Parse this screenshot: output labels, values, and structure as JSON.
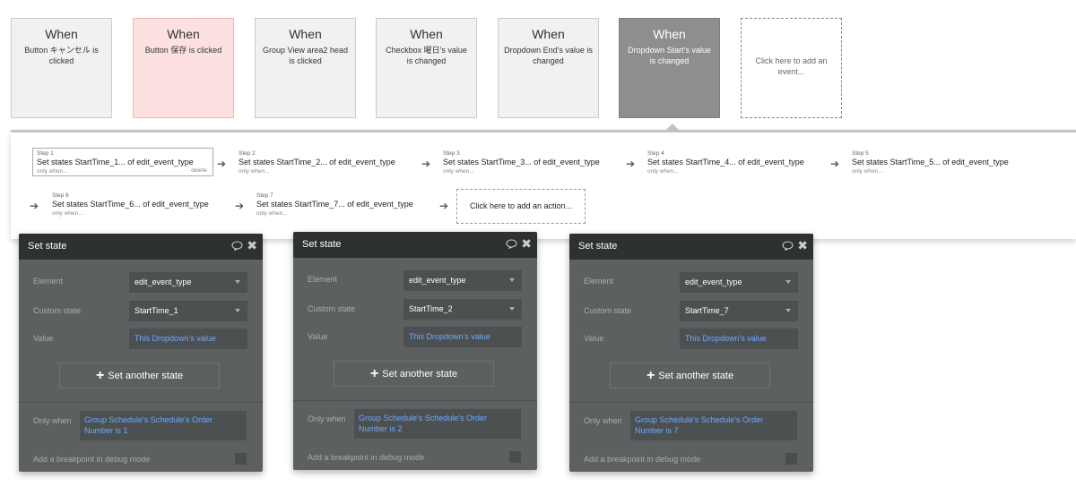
{
  "events": [
    {
      "when": "When",
      "desc": "Button キャンセル is clicked",
      "style": "normal"
    },
    {
      "when": "When",
      "desc": "Button 保存 is clicked",
      "style": "pink"
    },
    {
      "when": "When",
      "desc": "Group View area2 head is clicked",
      "style": "normal"
    },
    {
      "when": "When",
      "desc": "Checkbox 曜日's value is changed",
      "style": "normal"
    },
    {
      "when": "When",
      "desc": "Dropdown End's value is changed",
      "style": "normal"
    },
    {
      "when": "When",
      "desc": "Dropdown Start's value is changed",
      "style": "selected"
    }
  ],
  "add_event_label": "Click here to add an event...",
  "steps": [
    {
      "num": "Step 1",
      "text": "Set states StartTime_1... of edit_event_type",
      "only": "only when...",
      "delete": "delete"
    },
    {
      "num": "Step 2",
      "text": "Set states StartTime_2... of edit_event_type",
      "only": "only when..."
    },
    {
      "num": "Step 3",
      "text": "Set states StartTime_3... of edit_event_type",
      "only": "only when..."
    },
    {
      "num": "Step 4",
      "text": "Set states StartTime_4... of edit_event_type",
      "only": "only when..."
    },
    {
      "num": "Step 5",
      "text": "Set states StartTime_5... of edit_event_type",
      "only": "only when..."
    },
    {
      "num": "Step 6",
      "text": "Set states StartTime_6... of edit_event_type",
      "only": "only when..."
    },
    {
      "num": "Step 7",
      "text": "Set states StartTime_7... of edit_event_type",
      "only": "only when..."
    }
  ],
  "add_action_label": "Click here to add an action...",
  "editors": [
    {
      "title": "Set state",
      "element_label": "Element",
      "element_value": "edit_event_type",
      "custom_state_label": "Custom state",
      "custom_state_value": "StartTime_1",
      "value_label": "Value",
      "value_value": "This Dropdown's value",
      "set_another": "Set another state",
      "only_when_label": "Only when",
      "only_when_value": "Group Schedule's Schedule's Order Number is 1",
      "breakpoint_label": "Add a breakpoint in debug mode"
    },
    {
      "title": "Set state",
      "element_label": "Element",
      "element_value": "edit_event_type",
      "custom_state_label": "Custom state",
      "custom_state_value": "StartTime_2",
      "value_label": "Value",
      "value_value": "This Dropdown's value",
      "set_another": "Set another state",
      "only_when_label": "Only when",
      "only_when_value": "Group Schedule's Schedule's Order Number is 2",
      "breakpoint_label": "Add a breakpoint in debug mode"
    },
    {
      "title": "Set state",
      "element_label": "Element",
      "element_value": "edit_event_type",
      "custom_state_label": "Custom state",
      "custom_state_value": "StartTime_7",
      "value_label": "Value",
      "value_value": "This Dropdown's value",
      "set_another": "Set another state",
      "only_when_label": "Only when",
      "only_when_value": "Group Schedule's Schedule's Order Number is 7",
      "breakpoint_label": "Add a breakpoint in debug mode"
    }
  ],
  "icons": {
    "arrow": "arrow-right-icon",
    "comment": "comment-icon",
    "close": "close-icon",
    "plus": "plus-icon",
    "dropdown": "chevron-down-icon"
  },
  "colors": {
    "selected_event": "#8e8e8e",
    "pink_event": "#fde0e0",
    "editor_bg": "#5d6061",
    "editor_header": "#2e3132",
    "link_blue": "#6aa9ff"
  }
}
